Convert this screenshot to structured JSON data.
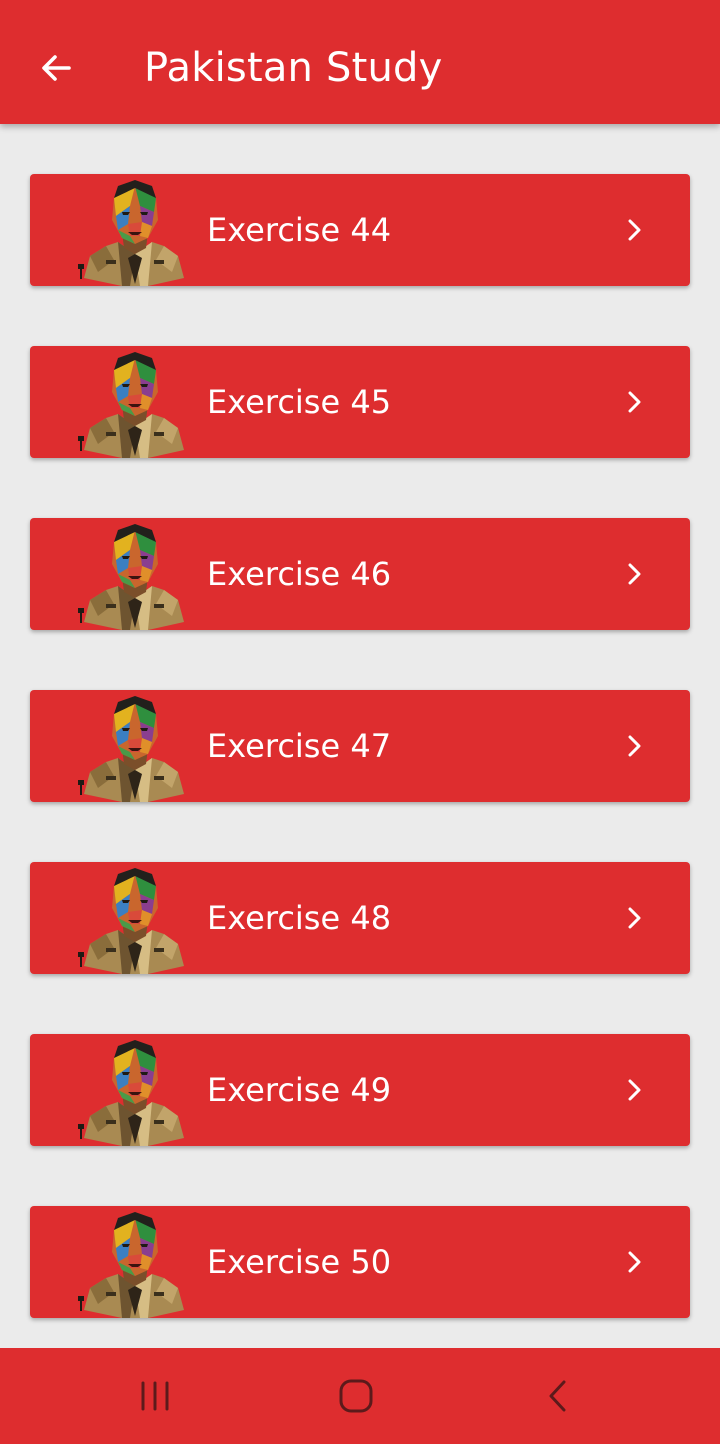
{
  "app_bar": {
    "title": "Pakistan Study",
    "back_icon": "arrow-left-icon",
    "background": "#de2d2f"
  },
  "exercises": [
    {
      "label": "Exercise 44"
    },
    {
      "label": "Exercise 45"
    },
    {
      "label": "Exercise 46"
    },
    {
      "label": "Exercise 47"
    },
    {
      "label": "Exercise 48"
    },
    {
      "label": "Exercise 49"
    },
    {
      "label": "Exercise 50"
    }
  ],
  "card_icons": {
    "thumbnail": "portrait-illustration-icon",
    "trailing": "chevron-right-icon"
  },
  "nav_bar": {
    "recent": "recent-apps-icon",
    "home": "home-icon",
    "back": "back-icon"
  },
  "colors": {
    "accent": "#de2d2f",
    "background": "#ebebeb",
    "text": "#ffffff"
  }
}
